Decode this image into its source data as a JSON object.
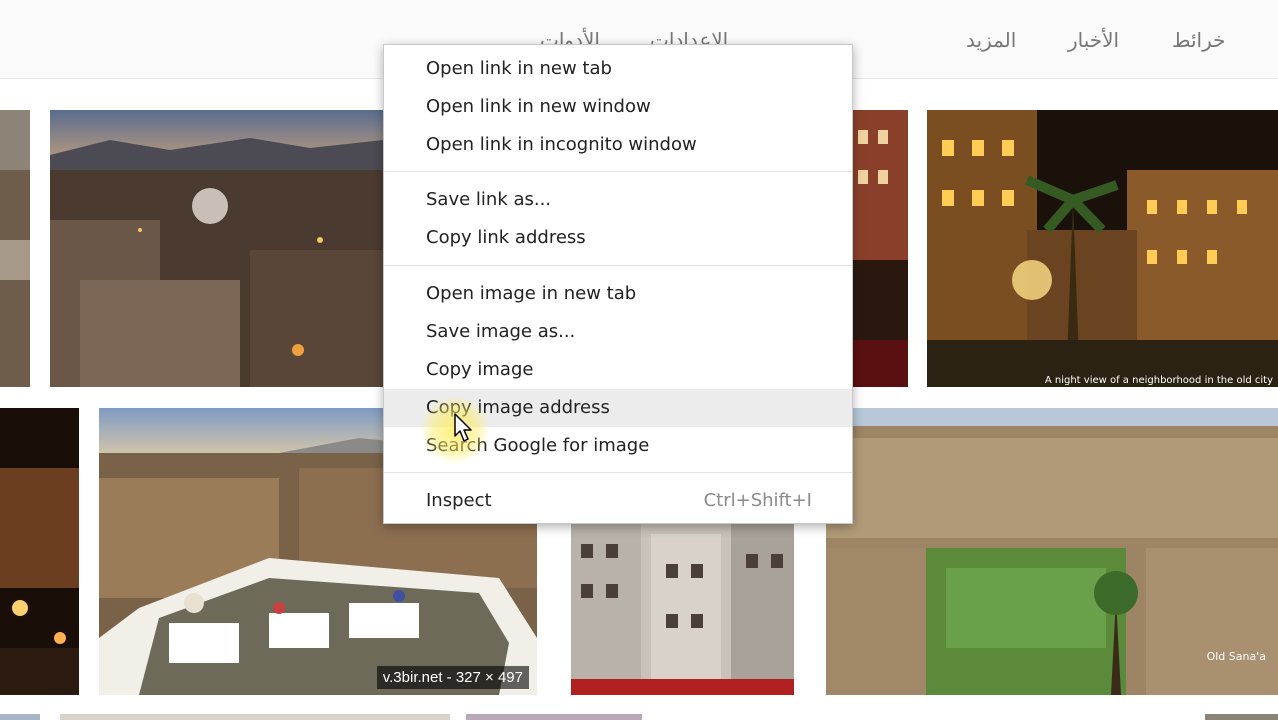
{
  "nav": {
    "tabs": [
      "خرائط",
      "الأخبار",
      "المزيد",
      "الإعدادات",
      "الأدوات"
    ]
  },
  "images": {
    "caption": "v.3bir.net - 327 × 497",
    "watermark_1": "A night view of a neighborhood in the old city",
    "watermark_2": "Old Sana'a"
  },
  "context_menu": {
    "open_link_new_tab": "Open link in new tab",
    "open_link_new_window": "Open link in new window",
    "open_link_incognito": "Open link in incognito window",
    "save_link_as": "Save link as...",
    "copy_link_address": "Copy link address",
    "open_image_new_tab": "Open image in new tab",
    "save_image_as": "Save image as...",
    "copy_image": "Copy image",
    "copy_image_address": "Copy image address",
    "search_google_image": "Search Google for image",
    "inspect": "Inspect",
    "inspect_shortcut": "Ctrl+Shift+I",
    "highlighted_item": "Copy image address"
  },
  "colors": {
    "menu_highlight": "#ececec",
    "cursor_glow": "#ffec5a"
  },
  "icons": [
    "mouse-pointer-icon"
  ]
}
